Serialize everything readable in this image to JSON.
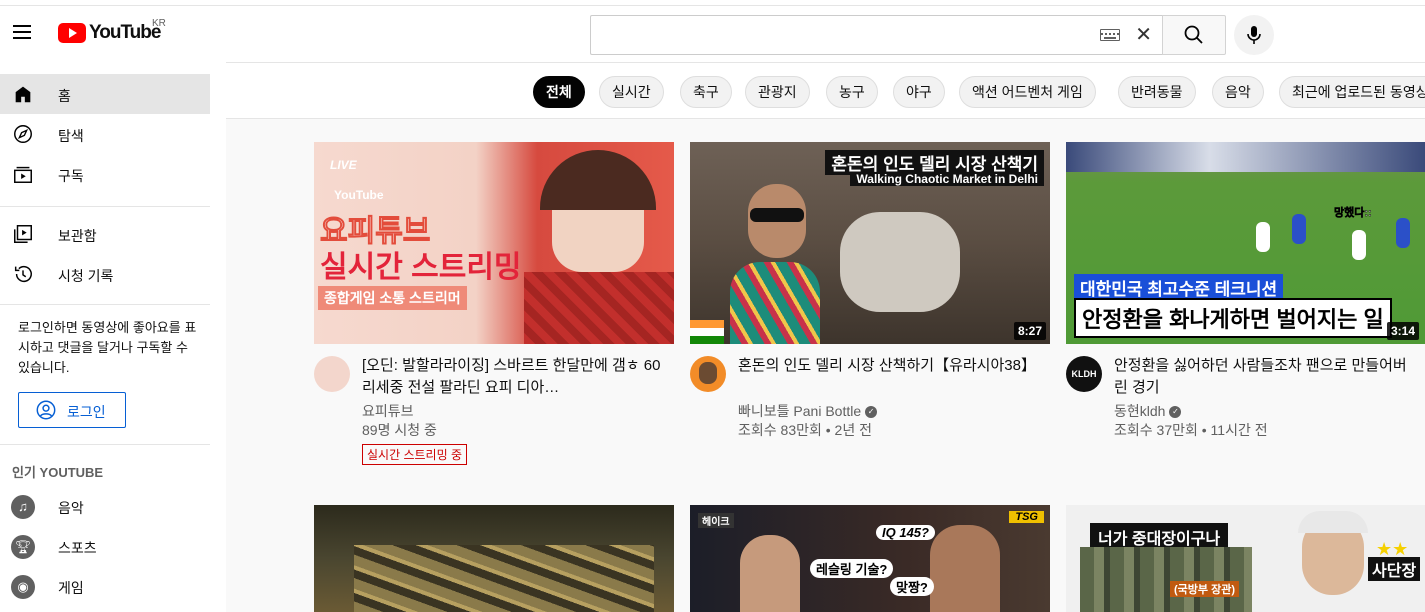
{
  "header": {
    "logo_text": "YouTube",
    "region": "KR",
    "search_value": "",
    "search_placeholder": ""
  },
  "sidebar": {
    "main_items": [
      {
        "label": "홈",
        "icon": "home-icon"
      },
      {
        "label": "탐색",
        "icon": "compass-icon"
      },
      {
        "label": "구독",
        "icon": "subscriptions-icon"
      }
    ],
    "library_items": [
      {
        "label": "보관함",
        "icon": "library-icon"
      },
      {
        "label": "시청 기록",
        "icon": "history-icon"
      }
    ],
    "login_message": "로그인하면 동영상에 좋아요를 표시하고 댓글을 달거나 구독할 수 있습니다.",
    "login_button": "로그인",
    "popular_title": "인기 YOUTUBE",
    "popular_items": [
      {
        "label": "음악",
        "icon": "music-icon"
      },
      {
        "label": "스포츠",
        "icon": "trophy-icon"
      },
      {
        "label": "게임",
        "icon": "gamepad-icon"
      }
    ]
  },
  "chips": [
    "전체",
    "실시간",
    "축구",
    "관광지",
    "농구",
    "야구",
    "액션 어드벤처 게임",
    "반려동물",
    "음악",
    "최근에 업로드된 동영상"
  ],
  "videos": [
    {
      "title": "[오딘: 발할라라이징] 스바르트 한달만에 갬ㅎ 60리세중 전설 팔라딘 요피 디아…",
      "channel": "요피튜브",
      "meta": "89명 시청 중",
      "badge": "실시간 스트리밍 중",
      "thumb_text": [
        "LIVE",
        "YouTube",
        "요피튜브",
        "실시간 스트리밍",
        "종합게임 소통 스트리머"
      ]
    },
    {
      "title": "혼돈의 인도 델리 시장 산책하기【유라시아38】",
      "channel": "빠니보틀 Pani Bottle",
      "meta": "조회수 83만회 • 2년 전",
      "duration": "8:27",
      "thumb_text": [
        "혼돈의 인도 델리 시장 산책기",
        "Walking Chaotic Market in Delhi"
      ]
    },
    {
      "title": "안정환을 싫어하던 사람들조차 팬으로 만들어버린 경기",
      "channel": "동현kldh",
      "meta": "조회수 37만회 • 11시간 전",
      "duration": "3:14",
      "avatar_text": "KLDH",
      "thumb_text": [
        "대한민국 최고수준 테크니션",
        "안정환을 화나게하면 벌어지는 일",
        "망했다::"
      ]
    },
    {
      "thumb_text": []
    },
    {
      "thumb_text": [
        "IQ 145?",
        "레슬링 기술?",
        "맞짱?",
        "TSG",
        "헤이크"
      ]
    },
    {
      "thumb_text": [
        "너가 중대장이구나",
        "(국방부 장관)",
        "사단장",
        "★★"
      ]
    }
  ]
}
